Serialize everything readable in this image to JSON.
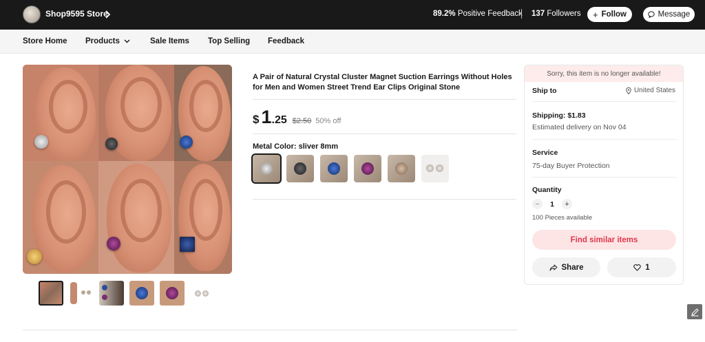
{
  "store": {
    "name": "Shop9595 Store",
    "feedback_pct": "89.2%",
    "feedback_label": "Positive Feedback",
    "followers_count": "137",
    "followers_label": "Followers",
    "follow_label": "Follow",
    "message_label": "Message"
  },
  "nav": {
    "items": [
      {
        "label": "Store Home"
      },
      {
        "label": "Products"
      },
      {
        "label": "Sale Items"
      },
      {
        "label": "Top Selling"
      },
      {
        "label": "Feedback"
      }
    ]
  },
  "product": {
    "title": "A Pair of Natural Crystal Cluster Magnet Suction Earrings Without Holes for Men and Women Street Trend Ear Clips Original Stone",
    "price": {
      "currency": "$",
      "integer": "1",
      "decimal": ".25",
      "original": "$2.50",
      "discount": "50% off"
    },
    "color_label": "Metal Color: sliver 8mm",
    "swatches": [
      {
        "color": "#b9b4ad",
        "selected": true
      },
      {
        "color": "#3a3a3f"
      },
      {
        "color": "#2a4f9a"
      },
      {
        "color": "#7a2f6e"
      },
      {
        "color": "#b79c86"
      },
      {
        "color": "#cfc4b8"
      }
    ]
  },
  "buybox": {
    "unavailable": "Sorry, this item is no longer available!",
    "ship_to_label": "Ship to",
    "ship_to_value": "United States",
    "shipping": "Shipping: $1.83",
    "delivery": "Estimated delivery on Nov 04",
    "service_label": "Service",
    "service_value": "75-day Buyer Protection",
    "quantity_label": "Quantity",
    "quantity_value": "1",
    "quantity_minus": "−",
    "quantity_plus": "+",
    "available": "100 Pieces available",
    "find_similar": "Find similar items",
    "share_label": "Share",
    "wishlist_count": "1"
  },
  "colors": {
    "topbar": "#191919",
    "accent": "#e0384c",
    "find_bg": "#fde5e5",
    "unavailable_bg": "#fdeceb"
  }
}
